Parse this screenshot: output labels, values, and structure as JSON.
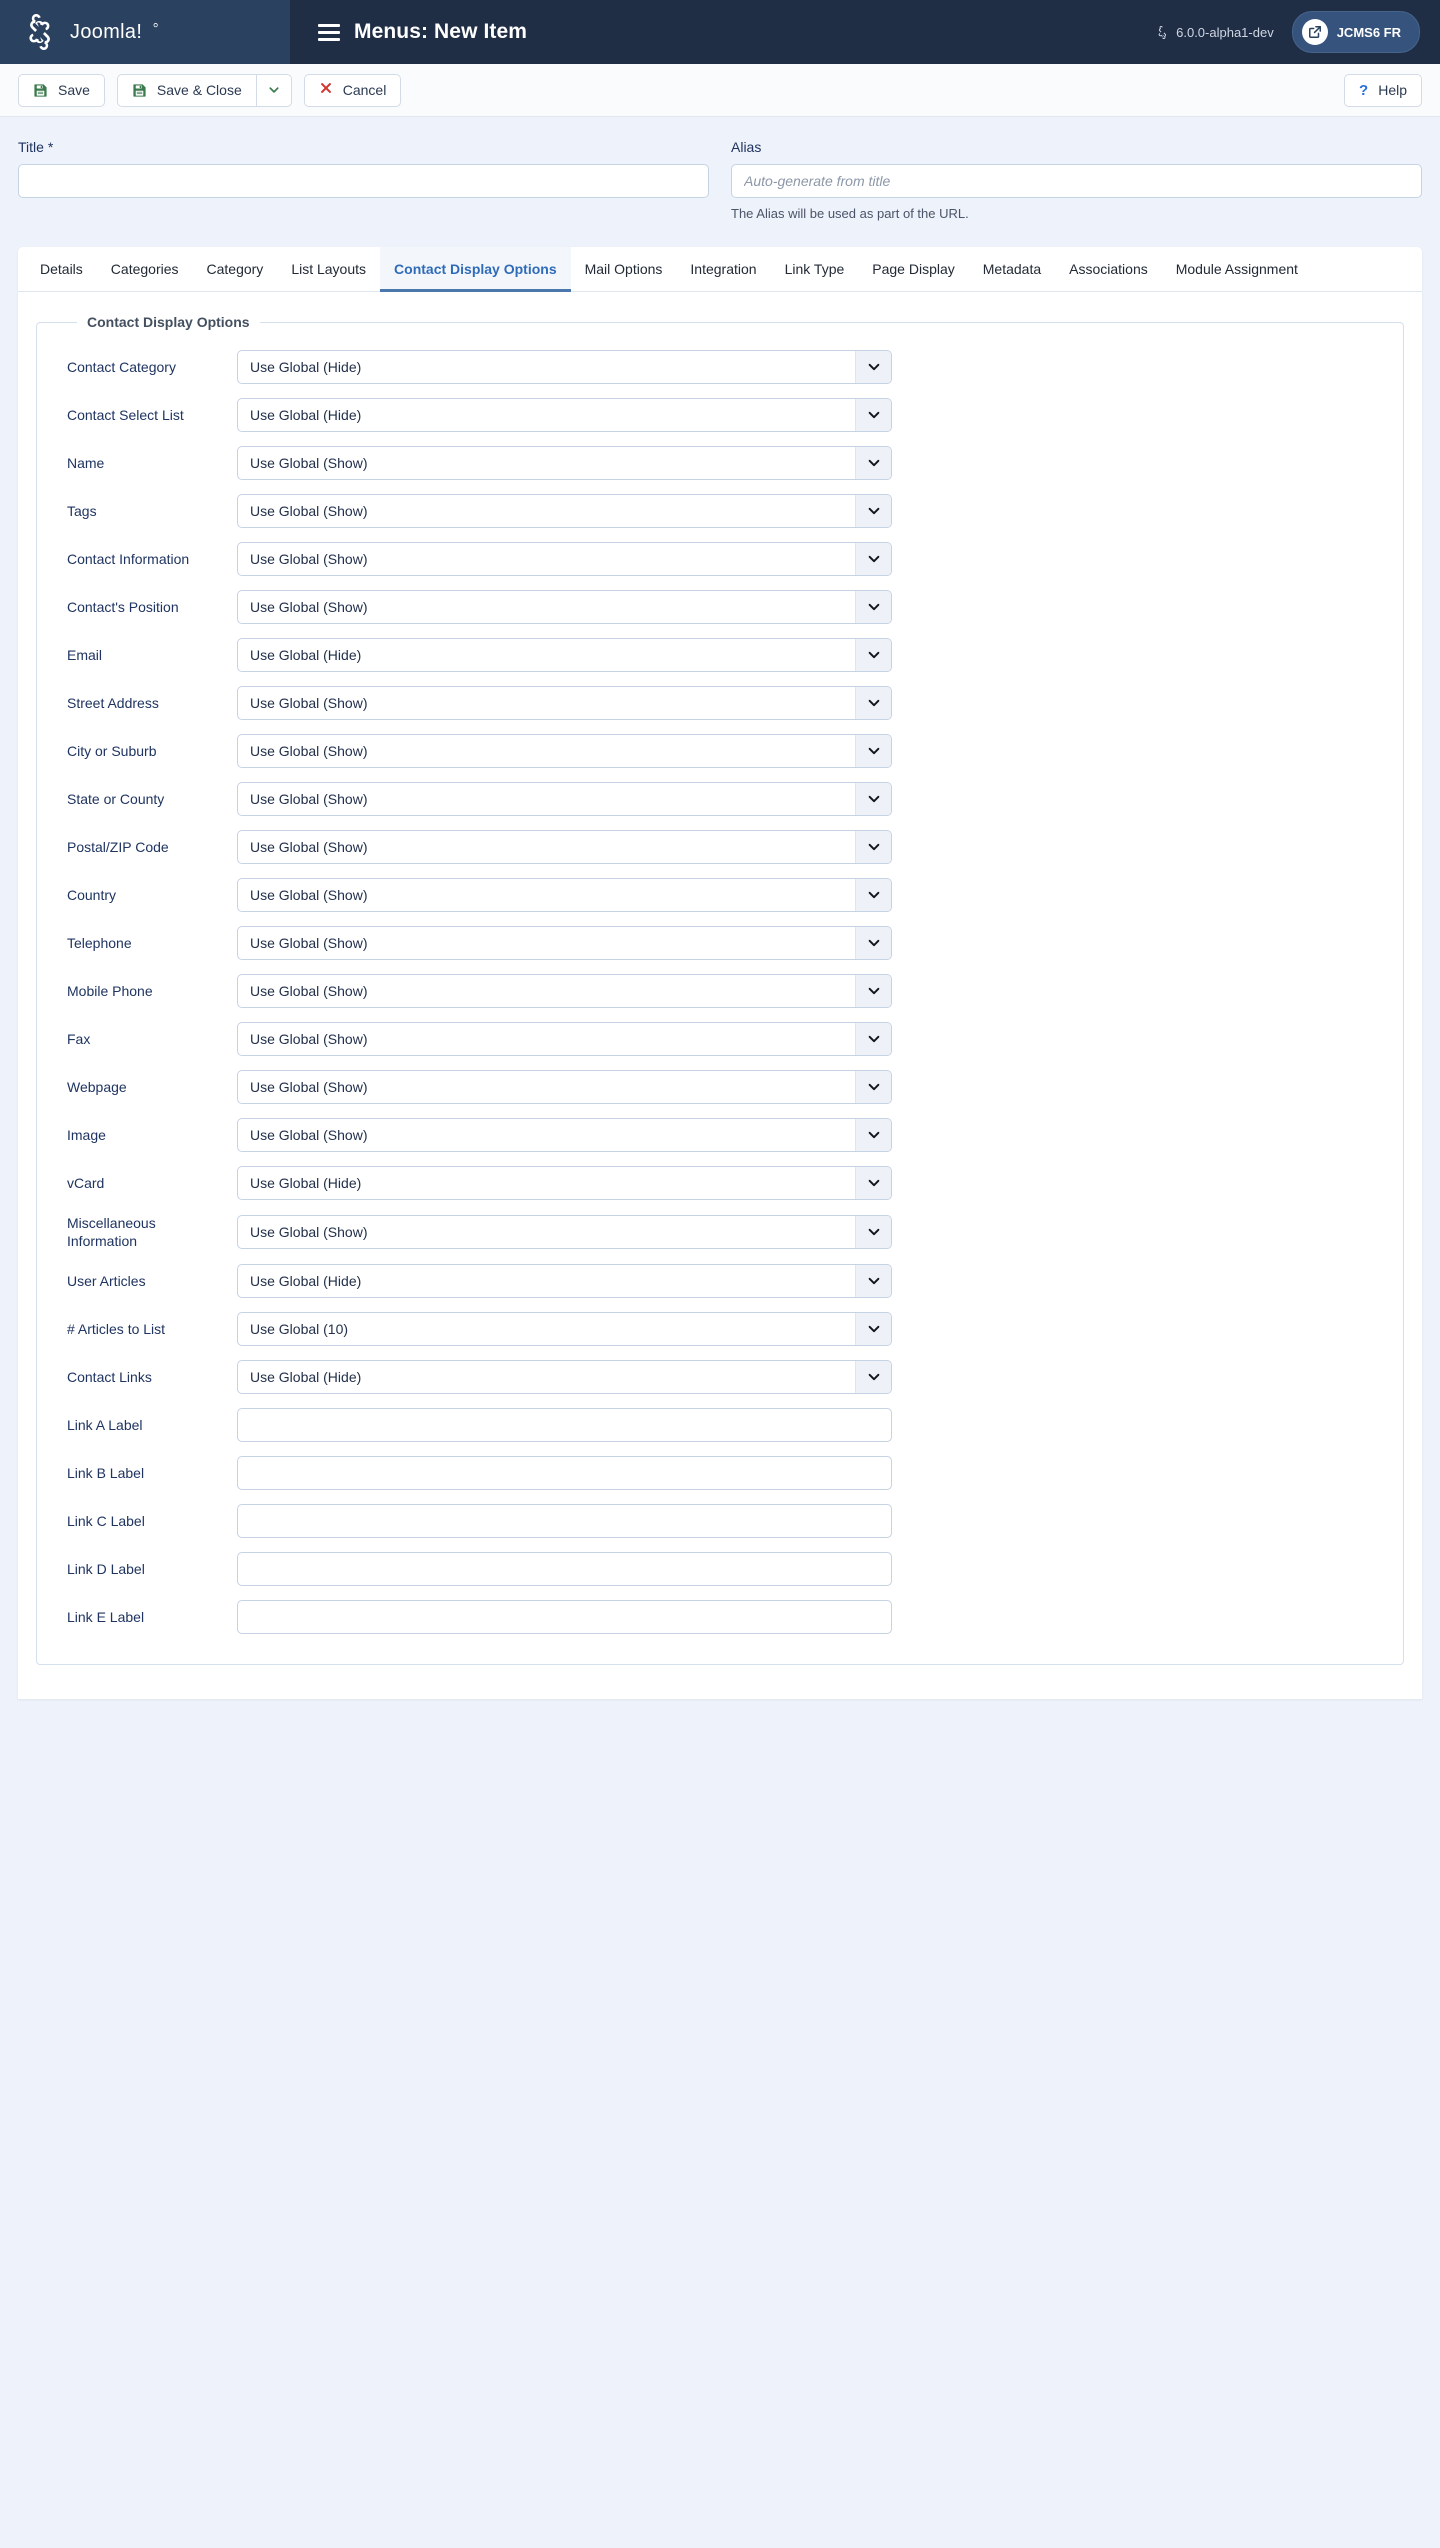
{
  "header": {
    "brand_name": "Joomla!",
    "logo_icon": "joomla-logo-icon",
    "menu_icon": "list-menu-icon",
    "title": "Menus: New Item",
    "version": "6.0.0-alpha1-dev",
    "version_icon": "joomla-mark-icon",
    "site_button_label": "JCMS6 FR",
    "site_button_icon": "external-link-icon"
  },
  "toolbar": {
    "save_label": "Save",
    "save_icon": "floppy-disk-icon",
    "save_close_label": "Save & Close",
    "save_close_icon": "floppy-disk-icon",
    "dropdown_icon": "chevron-down-icon",
    "cancel_label": "Cancel",
    "cancel_icon": "x-mark-icon",
    "help_label": "Help",
    "help_icon": "question-mark-icon"
  },
  "idfields": {
    "title": {
      "label": "Title *",
      "value": "",
      "placeholder": ""
    },
    "alias": {
      "label": "Alias",
      "value": "",
      "placeholder": "Auto-generate from title",
      "help": "The Alias will be used as part of the URL."
    }
  },
  "tabs": [
    {
      "label": "Details",
      "active": false
    },
    {
      "label": "Categories",
      "active": false
    },
    {
      "label": "Category",
      "active": false
    },
    {
      "label": "List Layouts",
      "active": false
    },
    {
      "label": "Contact Display Options",
      "active": true
    },
    {
      "label": "Mail Options",
      "active": false
    },
    {
      "label": "Integration",
      "active": false
    },
    {
      "label": "Link Type",
      "active": false
    },
    {
      "label": "Page Display",
      "active": false
    },
    {
      "label": "Metadata",
      "active": false
    },
    {
      "label": "Associations",
      "active": false
    },
    {
      "label": "Module Assignment",
      "active": false
    }
  ],
  "fieldset": {
    "legend": "Contact Display Options",
    "rows": [
      {
        "label": "Contact Category",
        "type": "select",
        "value": "Use Global (Hide)"
      },
      {
        "label": "Contact Select List",
        "type": "select",
        "value": "Use Global (Hide)"
      },
      {
        "label": "Name",
        "type": "select",
        "value": "Use Global (Show)"
      },
      {
        "label": "Tags",
        "type": "select",
        "value": "Use Global (Show)"
      },
      {
        "label": "Contact Information",
        "type": "select",
        "value": "Use Global (Show)"
      },
      {
        "label": "Contact's Position",
        "type": "select",
        "value": "Use Global (Show)"
      },
      {
        "label": "Email",
        "type": "select",
        "value": "Use Global (Hide)"
      },
      {
        "label": "Street Address",
        "type": "select",
        "value": "Use Global (Show)"
      },
      {
        "label": "City or Suburb",
        "type": "select",
        "value": "Use Global (Show)"
      },
      {
        "label": "State or County",
        "type": "select",
        "value": "Use Global (Show)"
      },
      {
        "label": "Postal/ZIP Code",
        "type": "select",
        "value": "Use Global (Show)"
      },
      {
        "label": "Country",
        "type": "select",
        "value": "Use Global (Show)"
      },
      {
        "label": "Telephone",
        "type": "select",
        "value": "Use Global (Show)"
      },
      {
        "label": "Mobile Phone",
        "type": "select",
        "value": "Use Global (Show)"
      },
      {
        "label": "Fax",
        "type": "select",
        "value": "Use Global (Show)"
      },
      {
        "label": "Webpage",
        "type": "select",
        "value": "Use Global (Show)"
      },
      {
        "label": "Image",
        "type": "select",
        "value": "Use Global (Show)"
      },
      {
        "label": "vCard",
        "type": "select",
        "value": "Use Global (Hide)"
      },
      {
        "label": "Miscellaneous Information",
        "type": "select",
        "value": "Use Global (Show)"
      },
      {
        "label": "User Articles",
        "type": "select",
        "value": "Use Global (Hide)"
      },
      {
        "label": "# Articles to List",
        "type": "select",
        "value": "Use Global (10)"
      },
      {
        "label": "Contact Links",
        "type": "select",
        "value": "Use Global (Hide)"
      },
      {
        "label": "Link A Label",
        "type": "text",
        "value": "",
        "placeholder": ""
      },
      {
        "label": "Link B Label",
        "type": "text",
        "value": "",
        "placeholder": ""
      },
      {
        "label": "Link C Label",
        "type": "text",
        "value": "",
        "placeholder": ""
      },
      {
        "label": "Link D Label",
        "type": "text",
        "value": "",
        "placeholder": ""
      },
      {
        "label": "Link E Label",
        "type": "text",
        "value": "",
        "placeholder": ""
      }
    ]
  },
  "colors": {
    "header_bg": "#1f2d45",
    "brand_bg": "#2a415f",
    "page_bg": "#eef2fa",
    "accent": "#2f6bb8",
    "label": "#1f3461",
    "save_green": "#3c7b4e",
    "cancel_red": "#d0342c",
    "help_blue": "#2a6fd6"
  }
}
